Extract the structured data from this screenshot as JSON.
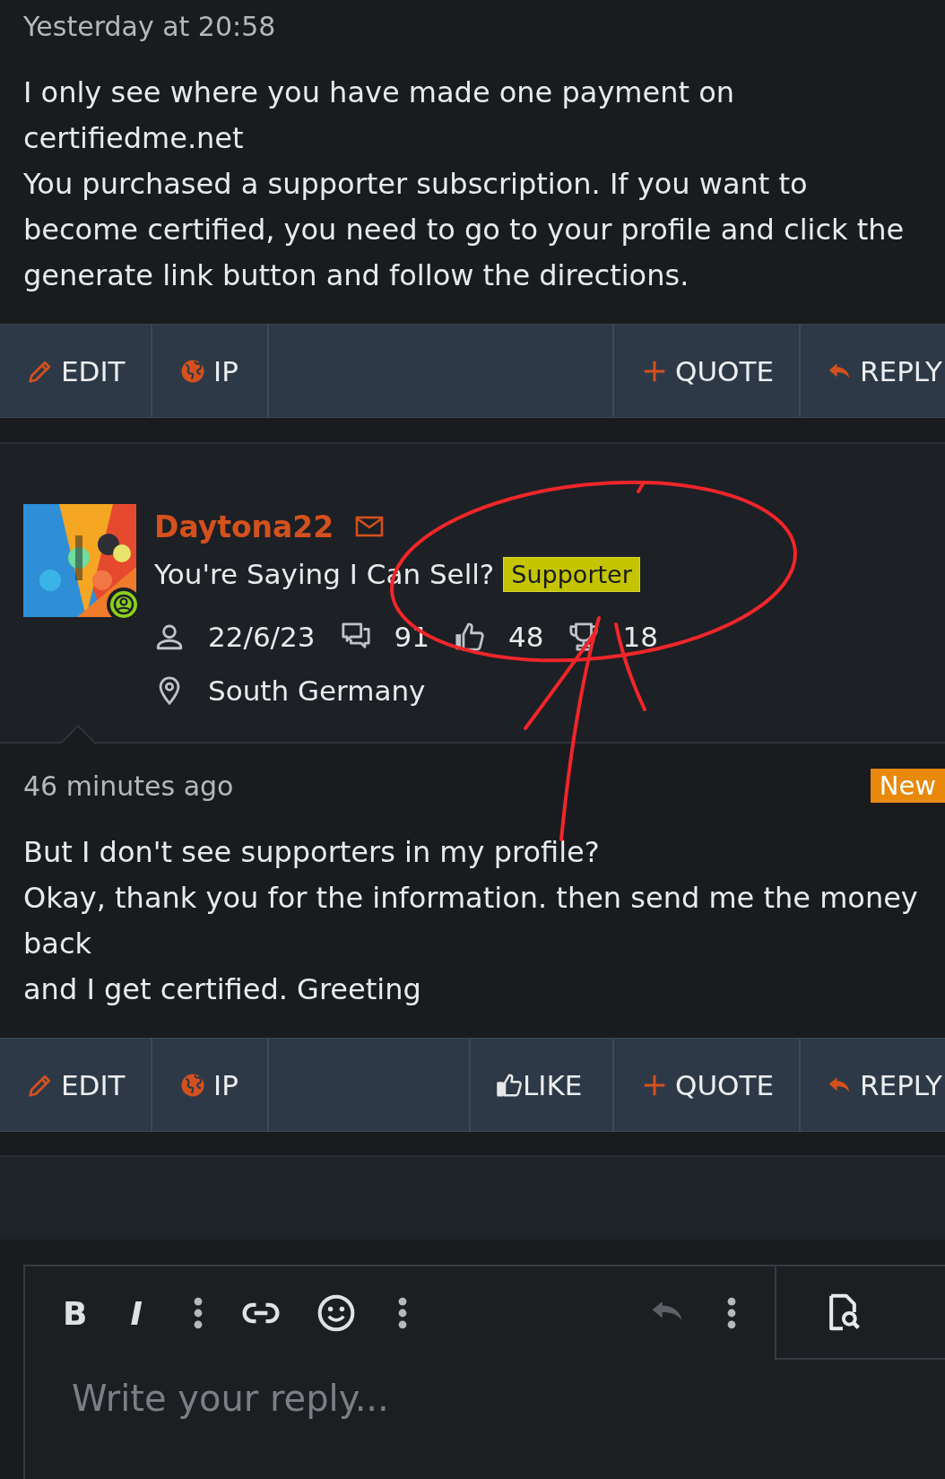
{
  "posts": [
    {
      "time": "Yesterday at 20:58",
      "body": [
        "I only see where you have made one payment on certifiedme.net",
        "You purchased a supporter subscription. If you want to become certified, you need to go to your profile and click the generate link button and follow the directions."
      ],
      "actions": [
        {
          "kind": "edit",
          "label": "EDIT"
        },
        {
          "kind": "ip",
          "label": "IP"
        },
        {
          "kind": "quote",
          "label": "QUOTE"
        },
        {
          "kind": "reply",
          "label": "REPLY"
        }
      ]
    },
    {
      "user": {
        "name": "Daytona22",
        "title": "You're Saying I Can Sell?",
        "badge": "Supporter",
        "online": true,
        "stats": [
          {
            "kind": "joined",
            "value": "22/6/23"
          },
          {
            "kind": "messages",
            "value": "91"
          },
          {
            "kind": "likes",
            "value": "48"
          },
          {
            "kind": "points",
            "value": "18"
          }
        ],
        "location": "South Germany"
      },
      "time": "46 minutes ago",
      "new_badge": "New",
      "body": [
        "But I don't see supporters in my profile?",
        "Okay, thank you for the information. then send me the money back",
        "and I get certified. Greeting"
      ],
      "actions": [
        {
          "kind": "edit",
          "label": "EDIT"
        },
        {
          "kind": "ip",
          "label": "IP"
        },
        {
          "kind": "like",
          "label": "LIKE"
        },
        {
          "kind": "quote",
          "label": "QUOTE"
        },
        {
          "kind": "reply",
          "label": "REPLY"
        }
      ]
    }
  ],
  "editor": {
    "toolbar": [
      {
        "kind": "bold",
        "label": "B",
        "disabled": false
      },
      {
        "kind": "italic",
        "label": "I",
        "disabled": false
      },
      {
        "kind": "more",
        "disabled": false
      },
      {
        "kind": "link",
        "disabled": false
      },
      {
        "kind": "emoji",
        "disabled": false
      },
      {
        "kind": "more",
        "disabled": false
      },
      {
        "kind": "undo",
        "disabled": true
      },
      {
        "kind": "more",
        "disabled": false
      }
    ],
    "placeholder": "Write your reply..."
  }
}
